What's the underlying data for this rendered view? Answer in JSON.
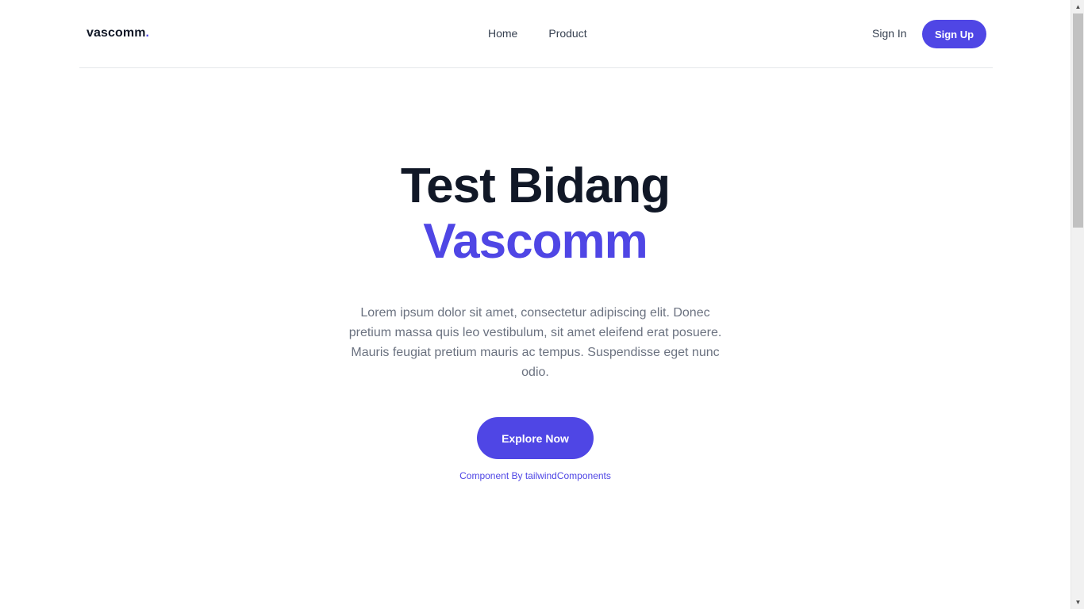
{
  "header": {
    "logo": "vascomm",
    "logo_dot": ".",
    "nav": [
      {
        "label": "Home"
      },
      {
        "label": "Product"
      }
    ],
    "signin_label": "Sign In",
    "signup_label": "Sign Up"
  },
  "hero": {
    "title_line1": "Test Bidang",
    "title_line2": "Vascomm",
    "description": "Lorem ipsum dolor sit amet, consectetur adipiscing elit. Donec pretium massa quis leo vestibulum, sit amet eleifend erat posuere. Mauris feugiat pretium mauris ac tempus. Suspendisse eget nunc odio.",
    "cta_label": "Explore Now",
    "credit": "Component By tailwindComponents"
  },
  "colors": {
    "accent": "#4f46e5",
    "heading": "#111827",
    "body_text": "#6b7280"
  },
  "icons": {
    "scroll_up": "arrow-up-icon",
    "scroll_down": "arrow-down-icon"
  }
}
